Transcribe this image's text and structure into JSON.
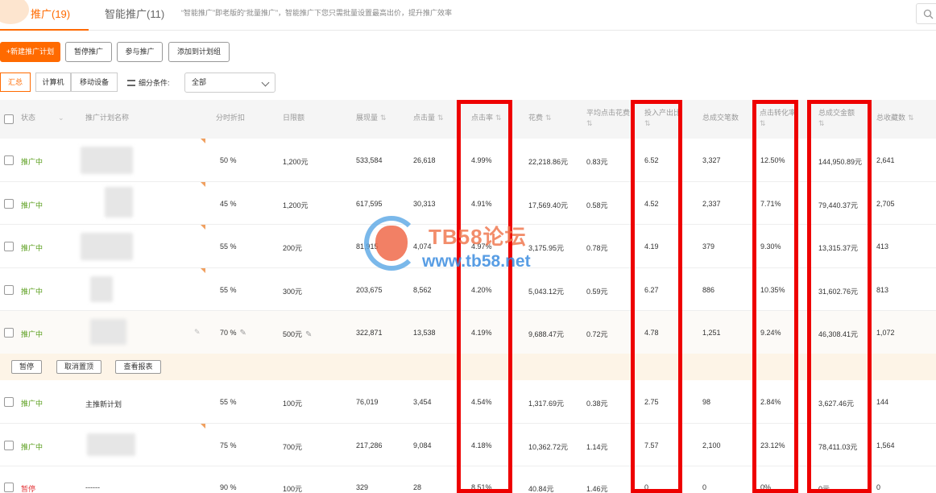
{
  "tabs": {
    "active": "推广(19)",
    "second": "智能推广(11)",
    "description": "“智能推广”即老版的“批量推广”，智能推广下您只需批量设置最高出价，提升推广效率"
  },
  "toolbar": {
    "new_plan": "+新建推广计划",
    "pause": "暂停推广",
    "join": "参与推广",
    "add_group": "添加到计划组"
  },
  "filter": {
    "segments": [
      "汇总",
      "计算机",
      "移动设备"
    ],
    "label": "细分条件:",
    "select_value": "全部"
  },
  "columns": {
    "status": "状态",
    "name": "推广计划名称",
    "discount": "分时折扣",
    "daily": "日限额",
    "impressions": "展现量",
    "clicks": "点击量",
    "ctr": "点击率",
    "spend": "花费",
    "avg_cpc": "平均点击花费",
    "roi": "投入产出比",
    "orders": "总成交笔数",
    "cvr": "点击转化率",
    "gmv": "总成交金额",
    "favorites": "总收藏数"
  },
  "rows": [
    {
      "status": "推广中",
      "name": "",
      "discount": "50 %",
      "daily": "1,200元",
      "impressions": "533,584",
      "clicks": "26,618",
      "ctr": "4.99%",
      "spend": "22,218.86元",
      "avg_cpc": "0.83元",
      "roi": "6.52",
      "orders": "3,327",
      "cvr": "12.50%",
      "gmv": "144,950.89元",
      "favorites": "2,641"
    },
    {
      "status": "推广中",
      "name": "",
      "discount": "45 %",
      "daily": "1,200元",
      "impressions": "617,595",
      "clicks": "30,313",
      "ctr": "4.91%",
      "spend": "17,569.40元",
      "avg_cpc": "0.58元",
      "roi": "4.52",
      "orders": "2,337",
      "cvr": "7.71%",
      "gmv": "79,440.37元",
      "favorites": "2,705"
    },
    {
      "status": "推广中",
      "name": "",
      "discount": "55 %",
      "daily": "200元",
      "impressions": "81,915",
      "clicks": "4,074",
      "ctr": "4.97%",
      "spend": "3,175.95元",
      "avg_cpc": "0.78元",
      "roi": "4.19",
      "orders": "379",
      "cvr": "9.30%",
      "gmv": "13,315.37元",
      "favorites": "413"
    },
    {
      "status": "推广中",
      "name": "",
      "discount": "55 %",
      "daily": "300元",
      "impressions": "203,675",
      "clicks": "8,562",
      "ctr": "4.20%",
      "spend": "5,043.12元",
      "avg_cpc": "0.59元",
      "roi": "6.27",
      "orders": "886",
      "cvr": "10.35%",
      "gmv": "31,602.76元",
      "favorites": "813"
    },
    {
      "status": "推广中",
      "name": "",
      "discount": "70 %",
      "daily": "500元",
      "impressions": "322,871",
      "clicks": "13,538",
      "ctr": "4.19%",
      "spend": "9,688.47元",
      "avg_cpc": "0.72元",
      "roi": "4.78",
      "orders": "1,251",
      "cvr": "9.24%",
      "gmv": "46,308.41元",
      "favorites": "1,072"
    },
    {
      "status": "推广中",
      "name": "主推新计划",
      "discount": "55 %",
      "daily": "100元",
      "impressions": "76,019",
      "clicks": "3,454",
      "ctr": "4.54%",
      "spend": "1,317.69元",
      "avg_cpc": "0.38元",
      "roi": "2.75",
      "orders": "98",
      "cvr": "2.84%",
      "gmv": "3,627.46元",
      "favorites": "144"
    },
    {
      "status": "推广中",
      "name": "",
      "discount": "75 %",
      "daily": "700元",
      "impressions": "217,286",
      "clicks": "9,084",
      "ctr": "4.18%",
      "spend": "10,362.72元",
      "avg_cpc": "1.14元",
      "roi": "7.57",
      "orders": "2,100",
      "cvr": "23.12%",
      "gmv": "78,411.03元",
      "favorites": "1,564"
    },
    {
      "status": "暂停",
      "name": "------",
      "discount": "90 %",
      "daily": "100元",
      "impressions": "329",
      "clicks": "28",
      "ctr": "8.51%",
      "spend": "40.84元",
      "avg_cpc": "1.46元",
      "roi": "0",
      "orders": "0",
      "cvr": "0%",
      "gmv": "0元",
      "favorites": "0"
    }
  ],
  "row_actions": {
    "pause": "暂停",
    "unpin": "取消置顶",
    "report": "查看报表"
  },
  "watermark": {
    "title": "TB58论坛",
    "url": "www.tb58.net"
  },
  "colors": {
    "accent": "#ff6a00",
    "highlight": "#ee0000",
    "status_on": "#5a9e1c",
    "status_off": "#e4393c"
  }
}
